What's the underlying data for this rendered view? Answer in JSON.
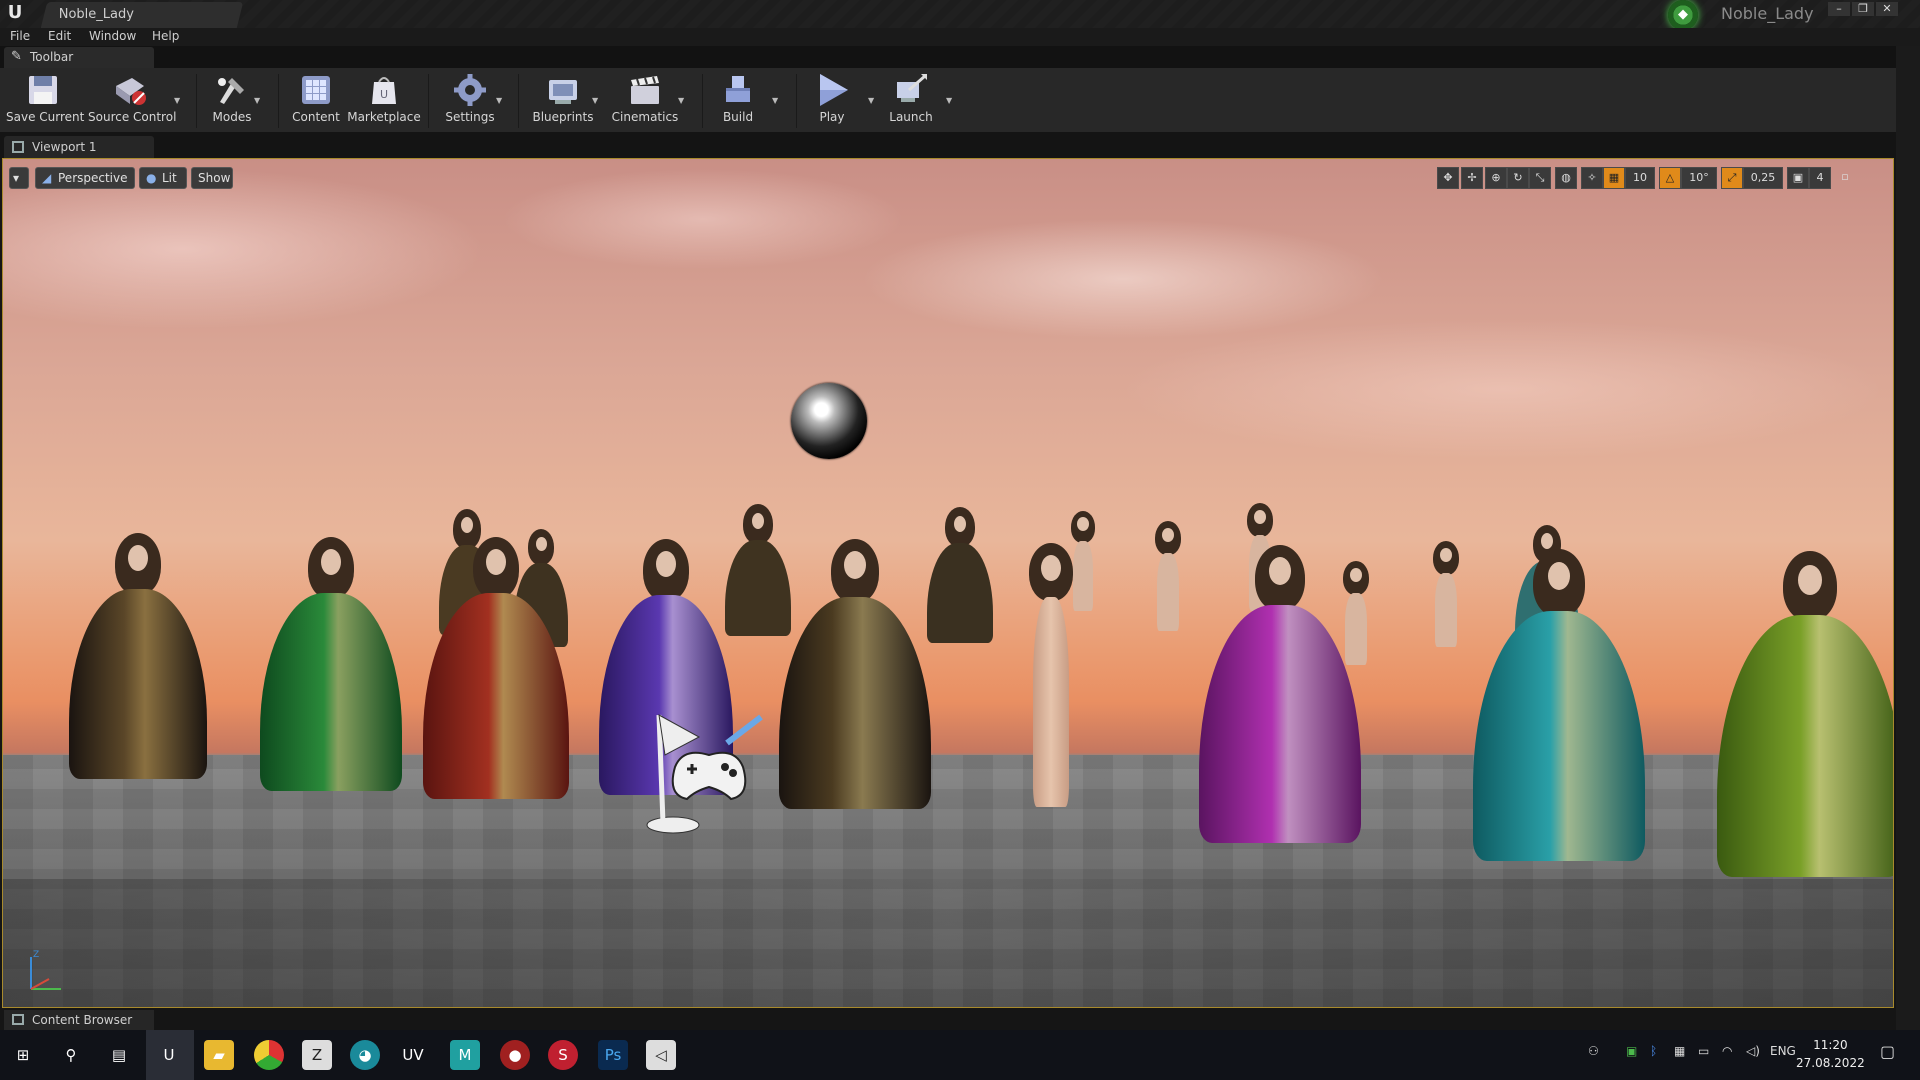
{
  "window": {
    "doc_tab": "Noble_Lady",
    "project_name": "Noble_Lady",
    "controls": [
      "–",
      "❐",
      "✕"
    ]
  },
  "menu": [
    "File",
    "Edit",
    "Window",
    "Help"
  ],
  "toolbar_tab": "Toolbar",
  "toolbar": {
    "save_current": "Save Current",
    "source_control": "Source Control",
    "modes": "Modes",
    "content": "Content",
    "marketplace": "Marketplace",
    "settings": "Settings",
    "blueprints": "Blueprints",
    "cinematics": "Cinematics",
    "build": "Build",
    "play": "Play",
    "launch": "Launch"
  },
  "viewport_tab": "Viewport 1",
  "viewport": {
    "perspective": "Perspective",
    "lit": "Lit",
    "show": "Show",
    "grid_snap": "10",
    "rotation_snap": "10°",
    "scale_snap": "0,25",
    "camera_speed": "4"
  },
  "content_browser_tab": "Content Browser",
  "taskbar": {
    "lang": "ENG",
    "time": "11:20",
    "date": "27.08.2022"
  },
  "colors": {
    "accent_selection": "#a88a2c",
    "project_green": "#3f9c3f",
    "snap_orange": "#e08a1a"
  }
}
